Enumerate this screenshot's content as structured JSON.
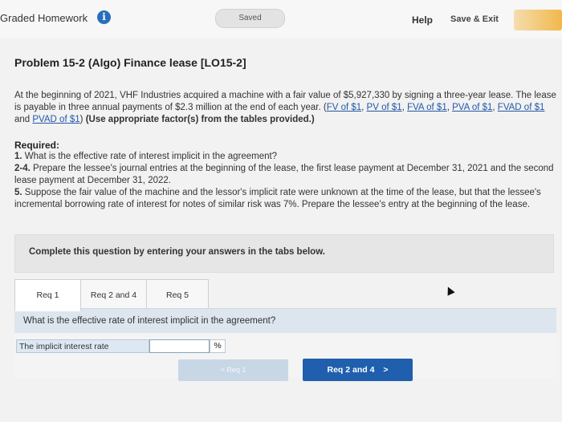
{
  "header": {
    "title": "Graded Homework",
    "info_glyph": "i",
    "status": "Saved",
    "help": "Help",
    "save_exit": "Save & Exit"
  },
  "problem": {
    "title": "Problem 15-2 (Algo) Finance lease [LO15-2]",
    "intro_text": "At the beginning of 2021, VHF Industries acquired a machine with a fair value of $5,927,330 by signing a three-year lease. The lease is payable in three annual payments of $2.3 million at the end of each year. (",
    "links": [
      "FV of $1",
      "PV of $1",
      "FVA of $1",
      "PVA of $1",
      "FVAD of $1",
      "PVAD of $1"
    ],
    "sep_comma": ", ",
    "sep_and": " and ",
    "close_paren": ")",
    "instruction_inline": "(Use appropriate factor(s) from the tables provided.)"
  },
  "required": {
    "heading": "Required:",
    "items": [
      {
        "num": "1.",
        "text": "What is the effective rate of interest implicit in the agreement?"
      },
      {
        "num": "2-4.",
        "text": "Prepare the lessee's journal entries at the beginning of the lease, the first lease payment at December 31, 2021 and the second lease payment at December 31, 2022."
      },
      {
        "num": "5.",
        "text": "Suppose the fair value of the machine and the lessor's implicit rate were unknown at the time of the lease, but that the lessee's incremental borrowing rate of interest for notes of similar risk was 7%. Prepare the lessee's entry at the beginning of the lease."
      }
    ]
  },
  "instruction_box": "Complete this question by entering your answers in the tabs below.",
  "tabs": [
    {
      "label": "Req 1",
      "active": true
    },
    {
      "label": "Req 2 and 4",
      "active": false
    },
    {
      "label": "Req 5",
      "active": false
    }
  ],
  "question": "What is the effective rate of interest implicit in the agreement?",
  "answer": {
    "label": "The implicit interest rate",
    "value": "",
    "unit": "%"
  },
  "nav": {
    "prev_label": "Req 1",
    "next_label": "Req 2 and 4",
    "prev_arrow": "<",
    "next_arrow": ">"
  },
  "colors": {
    "link": "#2358a8",
    "primary_button": "#1f5fae",
    "disabled_button": "#c7d7e6",
    "question_bar": "#dde6ee",
    "info_icon": "#2a6ebb"
  }
}
